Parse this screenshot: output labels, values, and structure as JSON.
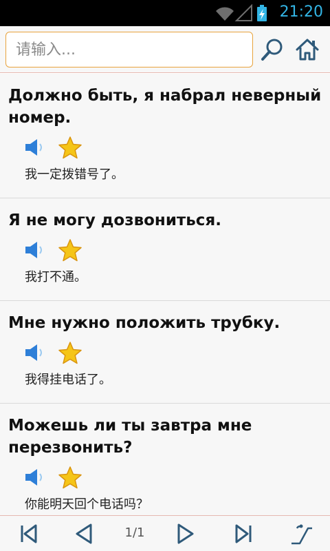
{
  "status_bar": {
    "time": "21:20",
    "icons": [
      "wifi-icon",
      "signal-icon",
      "battery-charging-icon"
    ],
    "accent_color": "#33b5e5"
  },
  "search": {
    "placeholder": "请输入...",
    "value": ""
  },
  "items": [
    {
      "ru": "Должно быть, я набрал неверный номер.",
      "zh": "我一定拨错号了。"
    },
    {
      "ru": "Я не могу дозвониться.",
      "zh": "我打不通。"
    },
    {
      "ru": "Мне нужно положить трубку.",
      "zh": "我得挂电话了。"
    },
    {
      "ru": "Можешь ли ты завтра мне перезвонить?",
      "zh": "你能明天回个电话吗？"
    }
  ],
  "pagination": {
    "page": "1/1"
  },
  "colors": {
    "search_border": "#e8a33c",
    "star_fill": "#f5c518",
    "speaker_fill": "#2e7fd8",
    "icon_stroke": "#2f5a7a"
  }
}
